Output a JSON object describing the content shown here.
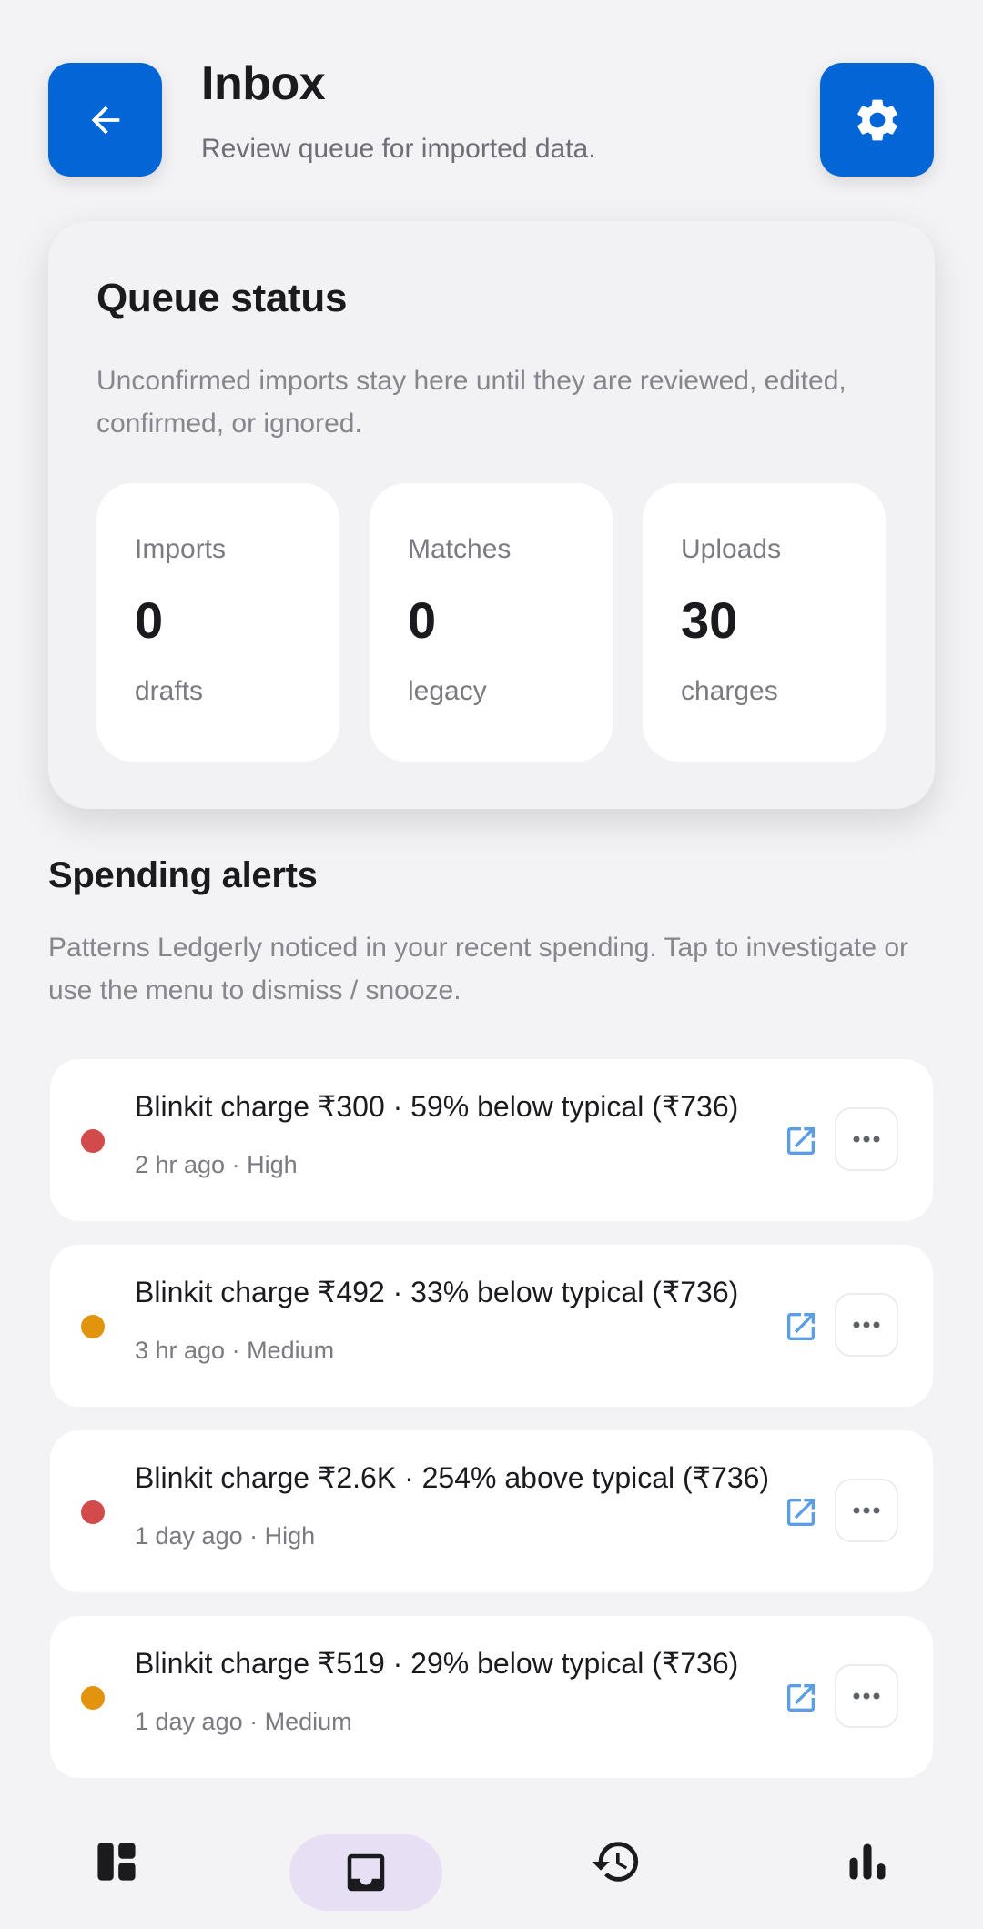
{
  "header": {
    "title": "Inbox",
    "subtitle": "Review queue for imported data."
  },
  "queue": {
    "title": "Queue status",
    "description": "Unconfirmed imports stay here until they are reviewed, edited, confirmed, or ignored.",
    "stats": [
      {
        "label": "Imports",
        "value": "0",
        "unit": "drafts"
      },
      {
        "label": "Matches",
        "value": "0",
        "unit": "legacy"
      },
      {
        "label": "Uploads",
        "value": "30",
        "unit": "charges"
      }
    ]
  },
  "alerts": {
    "title": "Spending alerts",
    "description": "Patterns Ledgerly noticed in your recent spending. Tap to investigate or use the menu to dismiss / snooze.",
    "items": [
      {
        "title": "Blinkit charge ₹300 · 59% below typical (₹736)",
        "meta": "2 hr ago · High",
        "severity": "high",
        "dot_color": "#d24a4a"
      },
      {
        "title": "Blinkit charge ₹492 · 33% below typical (₹736)",
        "meta": "3 hr ago · Medium",
        "severity": "medium",
        "dot_color": "#e3940f"
      },
      {
        "title": "Blinkit charge ₹2.6K · 254% above typical (₹736)",
        "meta": "1 day ago · High",
        "severity": "high",
        "dot_color": "#d24a4a"
      },
      {
        "title": "Blinkit charge ₹519 · 29% below typical (₹736)",
        "meta": "1 day ago · Medium",
        "severity": "medium",
        "dot_color": "#e3940f"
      }
    ]
  },
  "nav": {
    "items": [
      {
        "icon": "dashboard-icon",
        "selected": false
      },
      {
        "icon": "inbox-icon",
        "selected": true
      },
      {
        "icon": "history-icon",
        "selected": false
      },
      {
        "icon": "bar-chart-icon",
        "selected": false
      }
    ]
  },
  "colors": {
    "accent": "#0366d6",
    "high": "#d24a4a",
    "medium": "#e3940f",
    "nav_selected_bg": "#e7e0f5"
  }
}
